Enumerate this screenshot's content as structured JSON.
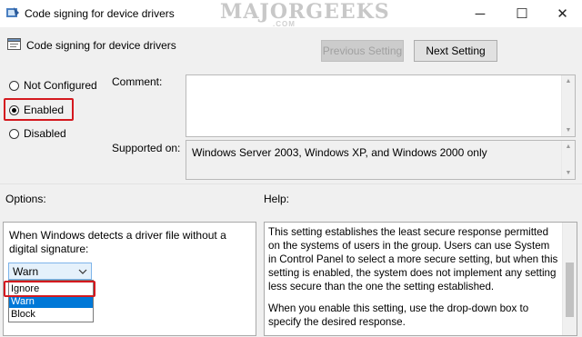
{
  "window": {
    "title": "Code signing for device drivers",
    "minimize_glyph": "─",
    "maximize_glyph": "☐",
    "close_glyph": "✕"
  },
  "watermark": {
    "text": "MAJORGEEKS",
    "sub": ".COM"
  },
  "header": {
    "title": "Code signing for device drivers",
    "prev_button": "Previous Setting",
    "next_button": "Next Setting"
  },
  "state": {
    "options": [
      "Not Configured",
      "Enabled",
      "Disabled"
    ],
    "selected": "Enabled"
  },
  "comment": {
    "label": "Comment:",
    "value": ""
  },
  "supported": {
    "label": "Supported on:",
    "value": "Windows Server 2003, Windows XP, and Windows 2000 only"
  },
  "options_panel": {
    "label": "Options:",
    "description": "When Windows detects a driver file without a digital signature:",
    "dropdown_value": "Warn",
    "dropdown_items": [
      "Ignore",
      "Warn",
      "Block"
    ],
    "highlighted_item": "Warn"
  },
  "help_panel": {
    "label": "Help:",
    "paragraphs": [
      "This setting establishes the least secure response permitted on the systems of users in the group. Users can use System in Control Panel to select a more secure setting, but when this setting is enabled, the system does not implement any setting less secure than the one the setting established.",
      "When you enable this setting, use the drop-down box to specify the desired response."
    ]
  },
  "colors": {
    "highlight_border": "#d4191f",
    "selection": "#0078d7"
  }
}
